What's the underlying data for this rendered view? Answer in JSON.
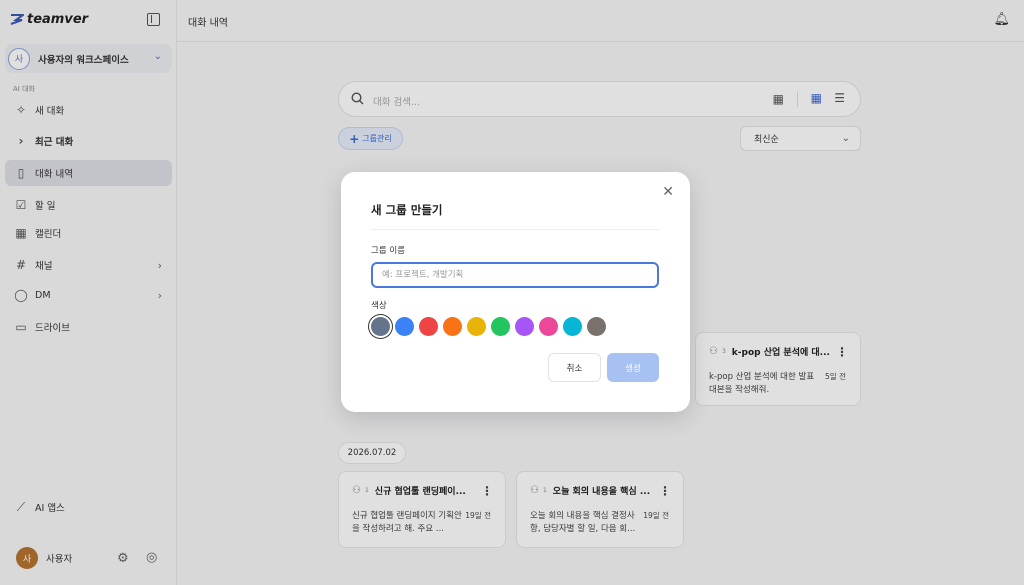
{
  "app": {
    "logo_text": "teamver"
  },
  "workspace": {
    "avatar": "사",
    "name": "사용자의 워크스페이스"
  },
  "sidebar": {
    "section_label": "AI 대화",
    "items": [
      {
        "label": "새 대화",
        "icon": "sparkle-icon"
      },
      {
        "label": "최근 대화",
        "icon": "chevron-right-icon"
      },
      {
        "label": "대화 내역",
        "icon": "book-icon"
      },
      {
        "label": "할 일",
        "icon": "checkbox-icon"
      },
      {
        "label": "캘린더",
        "icon": "calendar-icon"
      },
      {
        "label": "채널",
        "icon": "hash-icon"
      },
      {
        "label": "DM",
        "icon": "chat-bubble-icon"
      },
      {
        "label": "드라이브",
        "icon": "folder-icon"
      },
      {
        "label": "AI 앱스",
        "icon": "magic-wand-icon"
      }
    ]
  },
  "user": {
    "avatar": "사",
    "name": "사용자"
  },
  "topbar": {
    "title": "대화 내역"
  },
  "search": {
    "placeholder": "대화 검색..."
  },
  "toolbar": {
    "group_button": "그룹관리",
    "sort": "최신순"
  },
  "cards": [
    {
      "member_count": "3",
      "title": "k-pop 산업 분석에 대...",
      "preview": "k-pop 산업 분석에 대한 발표 대본을 작성해줘.",
      "time": "5일 전"
    },
    {
      "member_count": "1",
      "title": "신규 협업툴 랜딩페이...",
      "preview": "신규 협업툴 랜딩페이지 기획안을 작성하려고 해. 주요 ...",
      "time": "19일 전"
    },
    {
      "member_count": "1",
      "title": "오늘 회의 내용을 핵심 ...",
      "preview": "오늘 회의 내용을 핵심 결정사항, 담당자별 할 일, 다음 회...",
      "time": "19일 전"
    }
  ],
  "date_group": "2026.07.02",
  "modal": {
    "title": "새 그룹 만들기",
    "name_label": "그룹 이름",
    "name_placeholder": "예: 프로젝트, 개발기획",
    "color_label": "색상",
    "colors": [
      "#64748b",
      "#3b82f6",
      "#ef4444",
      "#f97316",
      "#eab308",
      "#22c55e",
      "#a855f7",
      "#ec4899",
      "#06b6d4",
      "#78716c"
    ],
    "selected_color": "#64748b",
    "cancel": "취소",
    "create": "생성"
  }
}
